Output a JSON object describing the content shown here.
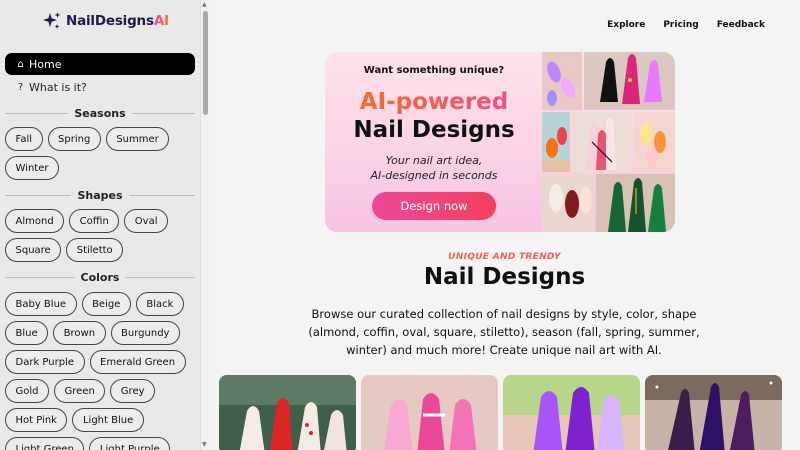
{
  "brand": {
    "name_prefix": "NailDesigns",
    "name_suffix": "AI"
  },
  "nav": {
    "home": "Home",
    "what": "What is it?"
  },
  "sections": {
    "seasons": {
      "title": "Seasons",
      "items": [
        "Fall",
        "Spring",
        "Summer",
        "Winter"
      ]
    },
    "shapes": {
      "title": "Shapes",
      "items": [
        "Almond",
        "Coffin",
        "Oval",
        "Square",
        "Stiletto"
      ]
    },
    "colors": {
      "title": "Colors",
      "items": [
        "Baby Blue",
        "Beige",
        "Black",
        "Blue",
        "Brown",
        "Burgundy",
        "Dark Purple",
        "Emerald Green",
        "Gold",
        "Green",
        "Grey",
        "Hot Pink",
        "Light Blue",
        "Light Green",
        "Light Purple"
      ]
    }
  },
  "topnav": {
    "explore": "Explore",
    "pricing": "Pricing",
    "feedback": "Feedback"
  },
  "hero": {
    "want": "Want something unique?",
    "ai": "AI-powered",
    "nail": "Nail Designs",
    "tag1": "Your nail art idea,",
    "tag2": "AI-designed in seconds",
    "button": "Design now"
  },
  "content": {
    "eyebrow": "UNIQUE AND TRENDY",
    "title": "Nail Designs",
    "description": "Browse our curated collection of nail designs by style, color, shape (almond, coffin, oval, square, stiletto), season (fall, spring, summer, winter) and much more! Create unique nail art with AI."
  },
  "colors": {
    "accent_pink": "#ec4899",
    "accent_orange": "#f97316",
    "brand_navy": "#1e1b4b"
  }
}
